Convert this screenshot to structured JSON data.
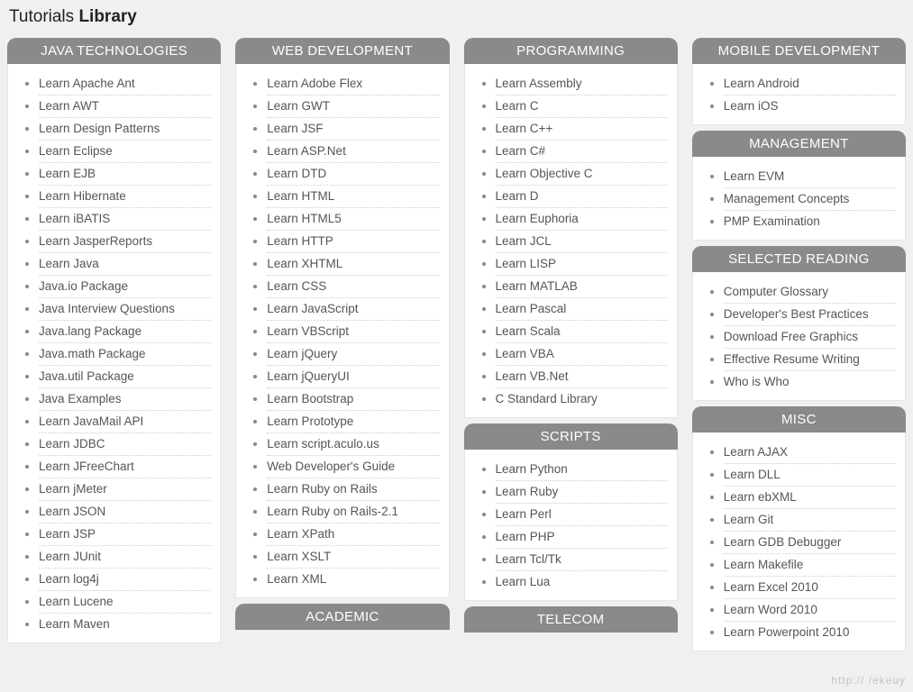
{
  "title": {
    "light": "Tutorials ",
    "bold": "Library"
  },
  "watermark": "http://                 /ekeuy",
  "columns": [
    {
      "sections": [
        {
          "header": "JAVA TECHNOLOGIES",
          "items": [
            "Learn Apache Ant",
            "Learn AWT",
            "Learn Design Patterns",
            "Learn Eclipse",
            "Learn EJB",
            "Learn Hibernate",
            "Learn iBATIS",
            "Learn JasperReports",
            "Learn Java",
            "Java.io Package",
            "Java Interview Questions",
            "Java.lang Package",
            "Java.math Package",
            "Java.util Package",
            "Java Examples",
            "Learn JavaMail API",
            "Learn JDBC",
            "Learn JFreeChart",
            "Learn jMeter",
            "Learn JSON",
            "Learn JSP",
            "Learn JUnit",
            "Learn log4j",
            "Learn Lucene",
            "Learn Maven"
          ]
        }
      ]
    },
    {
      "sections": [
        {
          "header": "WEB DEVELOPMENT",
          "items": [
            "Learn Adobe Flex",
            "Learn GWT",
            "Learn JSF",
            "Learn ASP.Net",
            "Learn DTD",
            "Learn HTML",
            "Learn HTML5",
            "Learn HTTP",
            "Learn XHTML",
            "Learn CSS",
            "Learn JavaScript",
            "Learn VBScript",
            "Learn jQuery",
            "Learn jQueryUI",
            "Learn Bootstrap",
            "Learn Prototype",
            "Learn script.aculo.us",
            "Web Developer's Guide",
            "Learn Ruby on Rails",
            "Learn Ruby on Rails-2.1",
            "Learn XPath",
            "Learn XSLT",
            "Learn XML"
          ]
        },
        {
          "header": "ACADEMIC",
          "items": []
        }
      ]
    },
    {
      "sections": [
        {
          "header": "PROGRAMMING",
          "items": [
            "Learn Assembly",
            "Learn C",
            "Learn C++",
            "Learn C#",
            "Learn Objective C",
            "Learn D",
            "Learn Euphoria",
            "Learn JCL",
            "Learn LISP",
            "Learn MATLAB",
            "Learn Pascal",
            "Learn Scala",
            "Learn VBA",
            "Learn VB.Net",
            "C Standard Library"
          ]
        },
        {
          "header": "SCRIPTS",
          "items": [
            "Learn Python",
            "Learn Ruby",
            "Learn Perl",
            "Learn PHP",
            "Learn Tcl/Tk",
            "Learn Lua"
          ]
        },
        {
          "header": "TELECOM",
          "items": []
        }
      ]
    },
    {
      "sections": [
        {
          "header": "MOBILE DEVELOPMENT",
          "items": [
            "Learn Android",
            "Learn iOS"
          ]
        },
        {
          "header": "MANAGEMENT",
          "items": [
            "Learn EVM",
            "Management Concepts",
            "PMP Examination"
          ]
        },
        {
          "header": "SELECTED READING",
          "items": [
            "Computer Glossary",
            "Developer's Best Practices",
            "Download Free Graphics",
            "Effective Resume Writing",
            "Who is Who"
          ]
        },
        {
          "header": "MISC",
          "items": [
            "Learn AJAX",
            "Learn DLL",
            "Learn ebXML",
            "Learn Git",
            "Learn GDB Debugger",
            "Learn Makefile",
            "Learn Excel 2010",
            "Learn Word 2010",
            "Learn Powerpoint 2010"
          ]
        }
      ]
    }
  ]
}
